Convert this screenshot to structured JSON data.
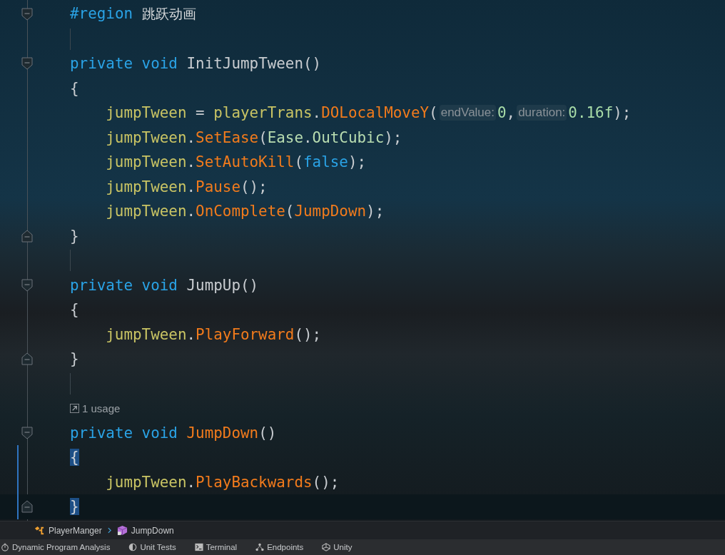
{
  "editor": {
    "lines": [
      {
        "fold_start": true,
        "tokens": [
          {
            "text": "#region ",
            "kind": "kw"
          },
          {
            "text": "跳跃动画",
            "kind": "cn"
          }
        ]
      },
      {
        "guide": true
      },
      {
        "fold_start": true,
        "tokens": [
          {
            "text": "private void ",
            "kind": "kw"
          },
          {
            "text": "InitJumpTween",
            "kind": "plain"
          },
          {
            "text": "()",
            "kind": "punct"
          }
        ]
      },
      {
        "tokens": [
          {
            "text": "{",
            "kind": "punct"
          }
        ],
        "children": [
          {
            "tokens": [
              {
                "text": "jumpTween",
                "kind": "var"
              },
              {
                "text": " = ",
                "kind": "punct"
              },
              {
                "text": "playerTrans",
                "kind": "var"
              },
              {
                "text": ".",
                "kind": "punct"
              },
              {
                "text": "DOLocalMoveY",
                "kind": "fn"
              },
              {
                "text": "(",
                "kind": "punct"
              },
              {
                "text": "endValue:",
                "kind": "hint"
              },
              {
                "text": "0",
                "kind": "num"
              },
              {
                "text": ",",
                "kind": "punct"
              },
              {
                "text": "duration:",
                "kind": "hint"
              },
              {
                "text": "0.16f",
                "kind": "num"
              },
              {
                "text": ");",
                "kind": "punct"
              }
            ]
          },
          {
            "tokens": [
              {
                "text": "jumpTween",
                "kind": "var"
              },
              {
                "text": ".",
                "kind": "punct"
              },
              {
                "text": "SetEase",
                "kind": "fn"
              },
              {
                "text": "(",
                "kind": "punct"
              },
              {
                "text": "Ease",
                "kind": "type"
              },
              {
                "text": ".",
                "kind": "punct"
              },
              {
                "text": "OutCubic",
                "kind": "type"
              },
              {
                "text": ");",
                "kind": "punct"
              }
            ]
          },
          {
            "tokens": [
              {
                "text": "jumpTween",
                "kind": "var"
              },
              {
                "text": ".",
                "kind": "punct"
              },
              {
                "text": "SetAutoKill",
                "kind": "fn"
              },
              {
                "text": "(",
                "kind": "punct"
              },
              {
                "text": "false",
                "kind": "kw"
              },
              {
                "text": ");",
                "kind": "punct"
              }
            ]
          },
          {
            "tokens": [
              {
                "text": "jumpTween",
                "kind": "var"
              },
              {
                "text": ".",
                "kind": "punct"
              },
              {
                "text": "Pause",
                "kind": "fn"
              },
              {
                "text": "();",
                "kind": "punct"
              }
            ]
          },
          {
            "tokens": [
              {
                "text": "jumpTween",
                "kind": "var"
              },
              {
                "text": ".",
                "kind": "punct"
              },
              {
                "text": "OnComplete",
                "kind": "fn"
              },
              {
                "text": "(",
                "kind": "punct"
              },
              {
                "text": "JumpDown",
                "kind": "fn"
              },
              {
                "text": ");",
                "kind": "punct"
              }
            ]
          }
        ]
      },
      {
        "fold_end": true,
        "tokens": [
          {
            "text": "}",
            "kind": "punct"
          }
        ]
      },
      {
        "guide": true
      },
      {
        "fold_start": true,
        "tokens": [
          {
            "text": "private void ",
            "kind": "kw"
          },
          {
            "text": "JumpUp",
            "kind": "plain"
          },
          {
            "text": "()",
            "kind": "punct"
          }
        ]
      },
      {
        "tokens": [
          {
            "text": "{",
            "kind": "punct"
          }
        ],
        "children": [
          {
            "tokens": [
              {
                "text": "jumpTween",
                "kind": "var"
              },
              {
                "text": ".",
                "kind": "punct"
              },
              {
                "text": "PlayForward",
                "kind": "fn"
              },
              {
                "text": "();",
                "kind": "punct"
              }
            ]
          }
        ]
      },
      {
        "fold_end": true,
        "tokens": [
          {
            "text": "}",
            "kind": "punct"
          }
        ]
      },
      {
        "guide": true
      },
      {
        "usage": "1 usage"
      },
      {
        "fold_start": true,
        "tokens": [
          {
            "text": "private void ",
            "kind": "kw"
          },
          {
            "text": "JumpDown",
            "kind": "fn"
          },
          {
            "text": "()",
            "kind": "punct"
          }
        ]
      },
      {
        "modified": true,
        "tokens": [
          {
            "text": "{",
            "kind": "match"
          }
        ],
        "children": [
          {
            "modified": true,
            "tokens": [
              {
                "text": "jumpTween",
                "kind": "var"
              },
              {
                "text": ".",
                "kind": "punct"
              },
              {
                "text": "PlayBackwards",
                "kind": "fn"
              },
              {
                "text": "();",
                "kind": "punct"
              }
            ]
          }
        ]
      },
      {
        "fold_end": true,
        "modified": true,
        "current": true,
        "tokens": [
          {
            "text": "}",
            "kind": "match"
          }
        ]
      }
    ]
  },
  "breadcrumbs": [
    {
      "label": "PlayerManger",
      "kind": "class"
    },
    {
      "label": "JumpDown",
      "kind": "method"
    }
  ],
  "tool_tabs": [
    {
      "label": "Dynamic Program Analysis"
    },
    {
      "label": "Unit Tests"
    },
    {
      "label": "Terminal"
    },
    {
      "label": "Endpoints"
    },
    {
      "label": "Unity"
    }
  ]
}
